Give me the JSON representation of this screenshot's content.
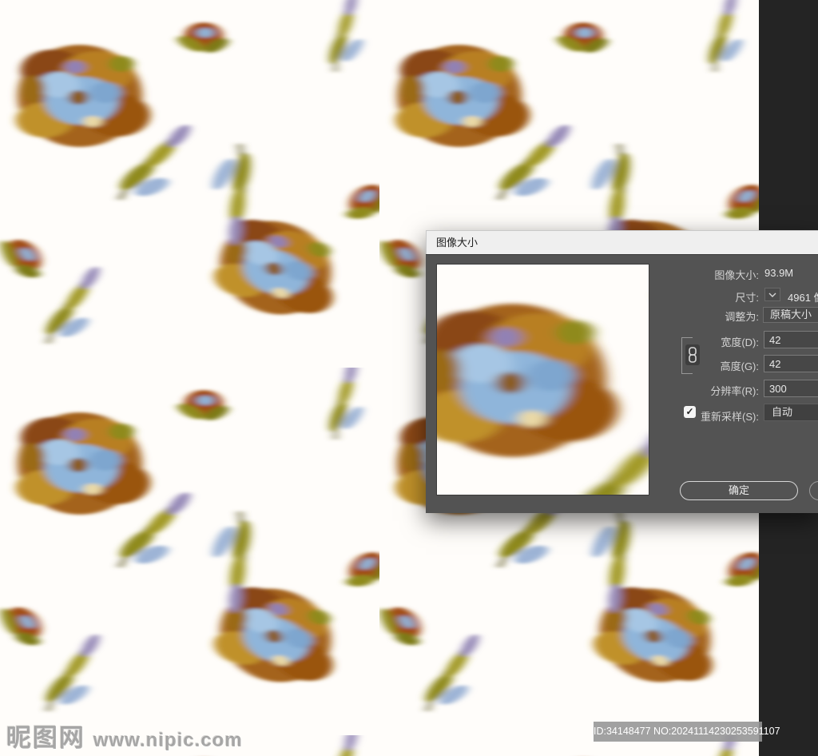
{
  "dialog": {
    "title": "图像大小",
    "image_size_label": "图像大小:",
    "image_size_value": "93.9M",
    "dimensions_label": "尺寸:",
    "dimensions_value": "4961 像",
    "fit_to_label": "调整为:",
    "fit_to_value": "原稿大小",
    "width_label": "宽度(D):",
    "width_value": "42",
    "height_label": "高度(G):",
    "height_value": "42",
    "resolution_label": "分辨率(R):",
    "resolution_value": "300",
    "resample_label": "重新采样(S):",
    "resample_value": "自动",
    "resample_checked": "✓",
    "ok_label": "确定"
  },
  "watermark": {
    "site_name": "昵图网",
    "site_url": "www.nipic.com",
    "id_text": "ID:34148477 NO:20241114230253591107"
  },
  "icons": {
    "dimensions_chevron": "chevron-down-icon",
    "constrain_link": "link-icon",
    "resample_check": "check-icon"
  },
  "colors": {
    "dialog_body": "#535353",
    "dialog_titlebar": "#efefef",
    "panel_dock": "#242424",
    "input_bg": "#474747",
    "pattern_rust": "#a4641e",
    "pattern_gold": "#c0912c",
    "pattern_blue": "#8fb5da",
    "pattern_olive": "#8f8a1e",
    "pattern_lavender": "#9181b5"
  }
}
